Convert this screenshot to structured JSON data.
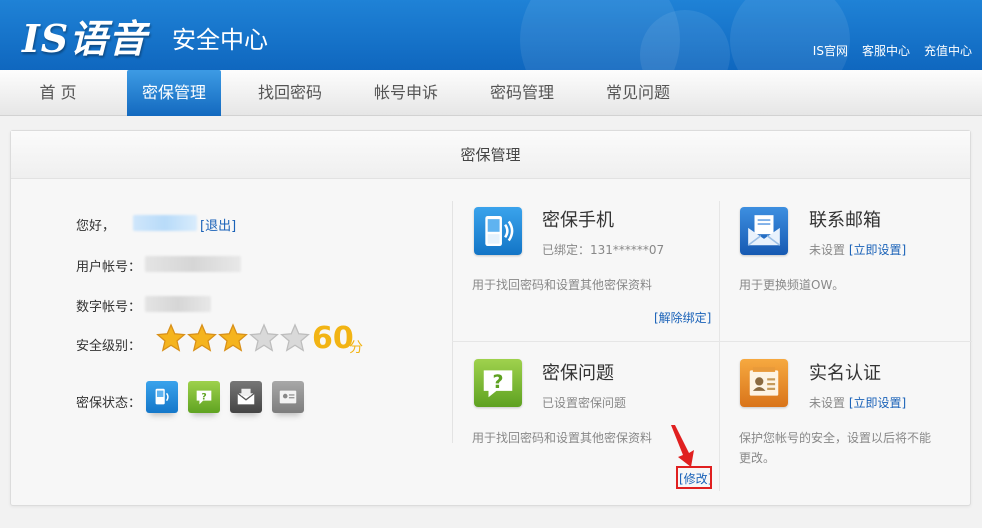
{
  "header": {
    "logo": "IS语音",
    "subtitle": "安全中心",
    "links": [
      "IS官网",
      "客服中心",
      "充值中心"
    ]
  },
  "nav": {
    "items": [
      "首 页",
      "密保管理",
      "找回密码",
      "帐号申诉",
      "密码管理",
      "常见问题"
    ],
    "active_index": 1
  },
  "card": {
    "title": "密保管理"
  },
  "account": {
    "greeting": "您好，",
    "logout": "[退出]",
    "user_account_label": "用户帐号：",
    "digit_account_label": "数字帐号：",
    "security_level_label": "安全级别：",
    "stars_filled": 3,
    "stars_total": 5,
    "score": "60",
    "score_unit": "分",
    "security_status_label": "密保状态："
  },
  "panels": {
    "phone": {
      "title": "密保手机",
      "status": "已绑定：131******07",
      "desc": "用于找回密码和设置其他密保资料",
      "action": "[解除绑定]"
    },
    "email": {
      "title": "联系邮箱",
      "status": "未设置",
      "status_link": "[立即设置]",
      "desc": "用于更换频道OW。"
    },
    "question": {
      "title": "密保问题",
      "status": "已设置密保问题",
      "desc": "用于找回密码和设置其他密保资料",
      "action": "[修改]"
    },
    "realname": {
      "title": "实名认证",
      "status": "未设置",
      "status_link": "[立即设置]",
      "desc": "保护您帐号的安全，设置以后将不能更改。"
    }
  },
  "colors": {
    "header_blue": "#1f82d6",
    "nav_active": "#1f7fd2",
    "link_blue": "#1a62b8",
    "score_gold": "#f2b414",
    "highlight_red": "#e02020"
  }
}
